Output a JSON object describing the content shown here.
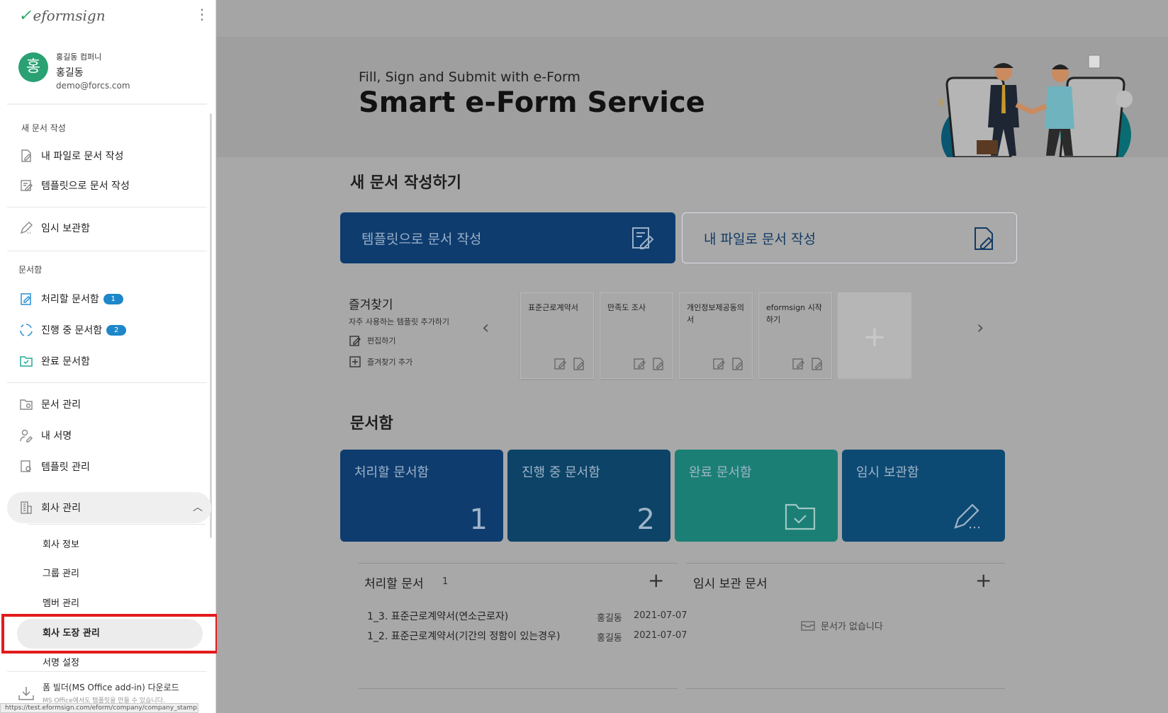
{
  "app": {
    "logo_text": "eformsign"
  },
  "profile": {
    "avatar_initial": "홍",
    "company": "홍길동 컴퍼니",
    "name": "홍길동",
    "email": "demo@forcs.com"
  },
  "sidebar": {
    "section_new": "새 문서 작성",
    "new_from_file": "내 파일로 문서 작성",
    "new_from_template": "템플릿으로 문서 작성",
    "drafts": "임시 보관함",
    "section_box": "문서함",
    "todo": "처리할 문서함",
    "todo_count": "1",
    "in_progress": "진행 중 문서함",
    "in_progress_count": "2",
    "completed": "완료 문서함",
    "doc_manage": "문서 관리",
    "my_signature": "내 서명",
    "template_manage": "템플릿 관리",
    "company_manage": "회사 관리",
    "company_sub": [
      "회사 정보",
      "그룹 관리",
      "멤버 관리",
      "회사 도장 관리",
      "서명 설정"
    ],
    "addin_title": "폼 빌더(MS Office add-in) 다운로드",
    "addin_sub": "MS Office에서도 템플릿을 만들 수 있습니다.",
    "status_url": "https://test.eformsign.com/eform/company/company_stamp.html"
  },
  "hero": {
    "subtitle": "Fill, Sign and Submit with e-Form",
    "title": "Smart e-Form Service"
  },
  "new_doc": {
    "heading": "새 문서 작성하기",
    "template_button": "템플릿으로 문서 작성",
    "file_button": "내 파일로 문서 작성"
  },
  "favorites": {
    "title": "즐겨찾기",
    "desc": "자주 사용하는 템플릿 추가하기",
    "edit": "편집하기",
    "add": "즐겨찾기 추가",
    "cards": [
      "표준근로계약서",
      "만족도 조사",
      "개인정보제공동의서",
      "eformsign 시작하기"
    ],
    "add_card": "+"
  },
  "boxes": {
    "heading": "문서함",
    "todo": {
      "label": "처리할 문서함",
      "count": "1",
      "color": "#0e3c6f"
    },
    "progress": {
      "label": "진행 중 문서함",
      "count": "2",
      "color": "#0c4367"
    },
    "completed": {
      "label": "완료 문서함",
      "color": "#1b7f76"
    },
    "drafts": {
      "label": "임시 보관함",
      "color": "#0d4a73"
    }
  },
  "todo_panel": {
    "title": "처리할 문서",
    "count": "1",
    "add": "+",
    "rows": [
      {
        "title": "1_3. 표준근로계약서(연소근로자)",
        "who": "홍길동",
        "date": "2021-07-07"
      },
      {
        "title": "1_2. 표준근로계약서(기간의 정함이 있는경우)",
        "who": "홍길동",
        "date": "2021-07-07"
      }
    ]
  },
  "draft_panel": {
    "title": "임시 보관 문서",
    "add": "+",
    "empty": "문서가 없습니다"
  }
}
